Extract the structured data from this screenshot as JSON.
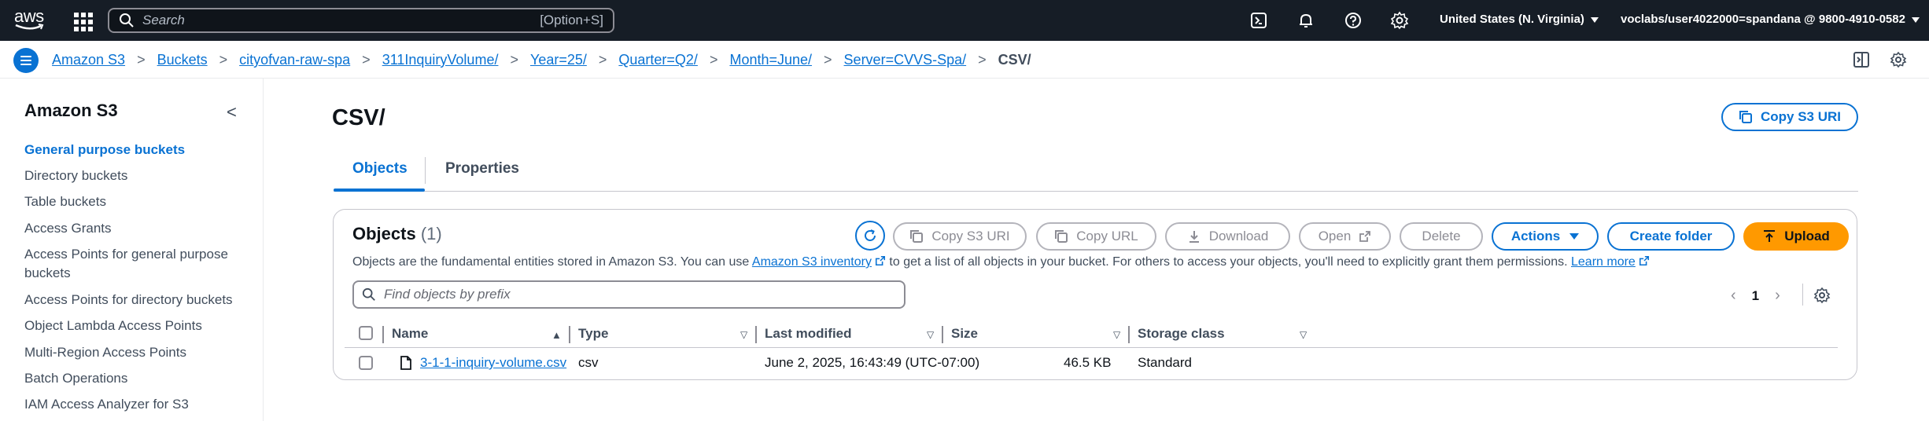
{
  "topnav": {
    "logo_text": "aws",
    "search_placeholder": "Search",
    "search_shortcut": "[Option+S]",
    "region": "United States (N. Virginia)",
    "account": "voclabs/user4022000=spandana @ 9800-4910-0582",
    "icons": [
      "services-grid-icon",
      "search-icon",
      "cloudshell-icon",
      "bell-icon",
      "help-icon",
      "settings-icon"
    ]
  },
  "breadcrumb": {
    "items": [
      "Amazon S3",
      "Buckets",
      "cityofvan-raw-spa",
      "311InquiryVolume/",
      "Year=25/",
      "Quarter=Q2/",
      "Month=June/",
      "Server=CVVS-Spa/"
    ],
    "current": "CSV/",
    "separator": ">"
  },
  "sidenav": {
    "title": "Amazon S3",
    "collapse_glyph": "<",
    "items": [
      {
        "label": "General purpose buckets",
        "active": true
      },
      {
        "label": "Directory buckets",
        "active": false
      },
      {
        "label": "Table buckets",
        "active": false
      },
      {
        "label": "Access Grants",
        "active": false
      },
      {
        "label": "Access Points for general purpose buckets",
        "active": false
      },
      {
        "label": "Access Points for directory buckets",
        "active": false
      },
      {
        "label": "Object Lambda Access Points",
        "active": false
      },
      {
        "label": "Multi-Region Access Points",
        "active": false
      },
      {
        "label": "Batch Operations",
        "active": false
      },
      {
        "label": "IAM Access Analyzer for S3",
        "active": false
      }
    ]
  },
  "page": {
    "title": "CSV/",
    "copy_uri_label": "Copy S3 URI"
  },
  "tabs": [
    {
      "label": "Objects",
      "active": true
    },
    {
      "label": "Properties",
      "active": false
    }
  ],
  "objects": {
    "title": "Objects",
    "count": "(1)",
    "desc_before": "Objects are the fundamental entities stored in Amazon S3. You can use",
    "desc_link": "Amazon S3 inventory",
    "desc_after": "to get a list of all objects in your bucket. For others to access your objects, you'll need to explicitly grant them permissions.",
    "learn_more": "Learn more",
    "filter_placeholder": "Find objects by prefix",
    "page_number": "1",
    "buttons": {
      "copy_uri": "Copy S3 URI",
      "copy_url": "Copy URL",
      "download": "Download",
      "open": "Open",
      "delete": "Delete",
      "actions": "Actions",
      "create_folder": "Create folder",
      "upload": "Upload"
    },
    "columns": [
      "Name",
      "Type",
      "Last modified",
      "Size",
      "Storage class"
    ],
    "rows": [
      {
        "name": "3-1-1-inquiry-volume.csv",
        "type": "csv",
        "last_modified": "June 2, 2025, 16:43:49 (UTC-07:00)",
        "size": "46.5 KB",
        "storage_class": "Standard"
      }
    ]
  },
  "colors": {
    "nav_bg": "#161d26",
    "link": "#0972d3",
    "primary_button": "#ff9900",
    "disabled": "#8c8c94"
  }
}
